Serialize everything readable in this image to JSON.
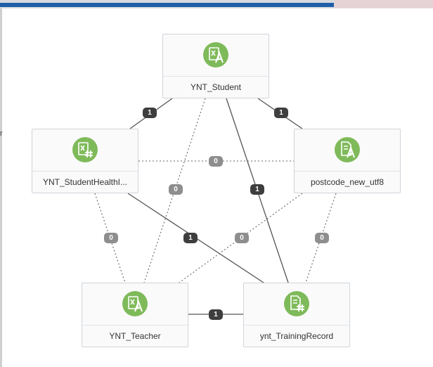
{
  "nodes": {
    "student": {
      "label": "YNT_Student",
      "icon": "excel-text-icon"
    },
    "health": {
      "label": "YNT_StudentHealthI...",
      "icon": "excel-number-icon"
    },
    "postcode": {
      "label": "postcode_new_utf8",
      "icon": "document-text-icon"
    },
    "teacher": {
      "label": "YNT_Teacher",
      "icon": "excel-text-icon"
    },
    "training": {
      "label": "ynt_TrainingRecord",
      "icon": "document-number-icon"
    }
  },
  "edges": [
    {
      "from": "YNT_Student",
      "to": "YNT_StudentHealthI...",
      "value": "1",
      "style": "solid"
    },
    {
      "from": "YNT_Student",
      "to": "postcode_new_utf8",
      "value": "1",
      "style": "solid"
    },
    {
      "from": "YNT_Student",
      "to": "ynt_TrainingRecord",
      "value": "1",
      "style": "solid"
    },
    {
      "from": "YNT_Student",
      "to": "YNT_Teacher",
      "value": "0",
      "style": "dashed"
    },
    {
      "from": "YNT_StudentHealthI...",
      "to": "postcode_new_utf8",
      "value": "0",
      "style": "dashed"
    },
    {
      "from": "YNT_StudentHealthI...",
      "to": "YNT_Teacher",
      "value": "0",
      "style": "dashed"
    },
    {
      "from": "YNT_StudentHealthI...",
      "to": "ynt_TrainingRecord",
      "value": "1",
      "style": "solid"
    },
    {
      "from": "postcode_new_utf8",
      "to": "YNT_Teacher",
      "value": "0",
      "style": "dashed"
    },
    {
      "from": "postcode_new_utf8",
      "to": "ynt_TrainingRecord",
      "value": "0",
      "style": "dashed"
    },
    {
      "from": "YNT_Teacher",
      "to": "ynt_TrainingRecord",
      "value": "1",
      "style": "solid"
    }
  ],
  "colors": {
    "icon_green": "#7fba5a",
    "badge_solid": "#3e3e3e",
    "badge_dashed": "#8e8e8e",
    "edge": "#555555"
  }
}
